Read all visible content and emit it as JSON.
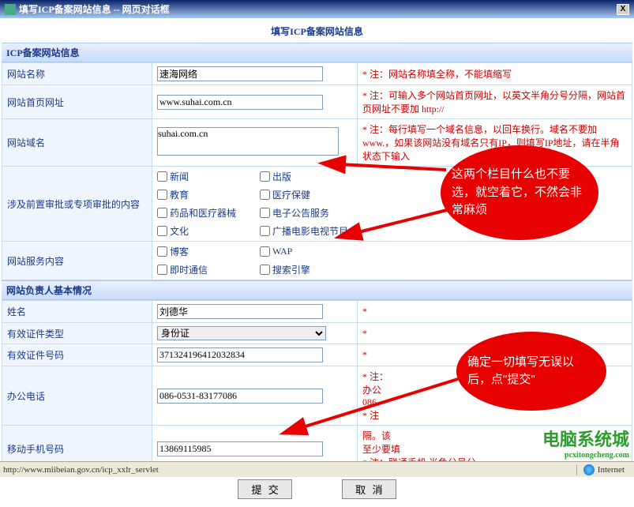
{
  "window": {
    "title": "填写ICP备案网站信息 -- 网页对话框",
    "close": "X"
  },
  "page_title": "填写ICP备案网站信息",
  "sections": {
    "site_info": "ICP备案网站信息",
    "owner_info": "网站负责人基本情况"
  },
  "fields": {
    "site_name": {
      "label": "网站名称",
      "value": "速海网络",
      "note": "* 注：网站名称填全称，不能填缩写"
    },
    "homepage": {
      "label": "网站首页网址",
      "value": "www.suhai.com.cn",
      "note": "* 注：可输入多个网站首页网址，以英文半角分号分隔，网站首页网址不要加 http://"
    },
    "domain": {
      "label": "网站域名",
      "value": "suhai.com.cn",
      "note": "* 注：每行填写一个域名信息，以回车换行。域名不要加 www.，如果该网站没有域名只有IP，则填写IP地址，请在半角状态下输入"
    },
    "pre_approval": {
      "label": "涉及前置审批或专项审批的内容"
    },
    "service": {
      "label": "网站服务内容"
    },
    "owner_name": {
      "label": "姓名",
      "value": "刘德华"
    },
    "id_type": {
      "label": "有效证件类型",
      "value": "身份证"
    },
    "id_no": {
      "label": "有效证件号码",
      "value": "371324196412032834"
    },
    "office_tel": {
      "label": "办公电话",
      "value": "086-0531-83177086",
      "note": "* 注：\n办公\n086-\n* 注"
    },
    "mobile": {
      "label": "移动手机号码",
      "value": "13869115985",
      "note": "隔。该\n至少要填\n* 注：联通手机                       半角分号分"
    }
  },
  "checkboxes": {
    "pre": [
      [
        "新闻",
        "出版"
      ],
      [
        "教育",
        "医疗保健"
      ],
      [
        "药品和医疗器械",
        "电子公告服务"
      ],
      [
        "文化",
        "广播电影电视节目"
      ]
    ],
    "svc": [
      [
        "博客",
        "WAP"
      ],
      [
        "即时通信",
        "搜索引擎"
      ]
    ]
  },
  "buttons": {
    "submit": "提交",
    "cancel": "取消"
  },
  "annotations": {
    "bubble1": "这两个栏目什么也不要选，就空着它，不然会非常麻烦",
    "bubble2": "确定一切填写无误以后，点\"提交\""
  },
  "statusbar": {
    "url": "http://www.miibeian.gov.cn/icp_xxlr_servlet",
    "zone": "Internet"
  },
  "watermark": {
    "main": "电脑系统城",
    "sub": "pcxitongcheng.com"
  },
  "star": "*"
}
